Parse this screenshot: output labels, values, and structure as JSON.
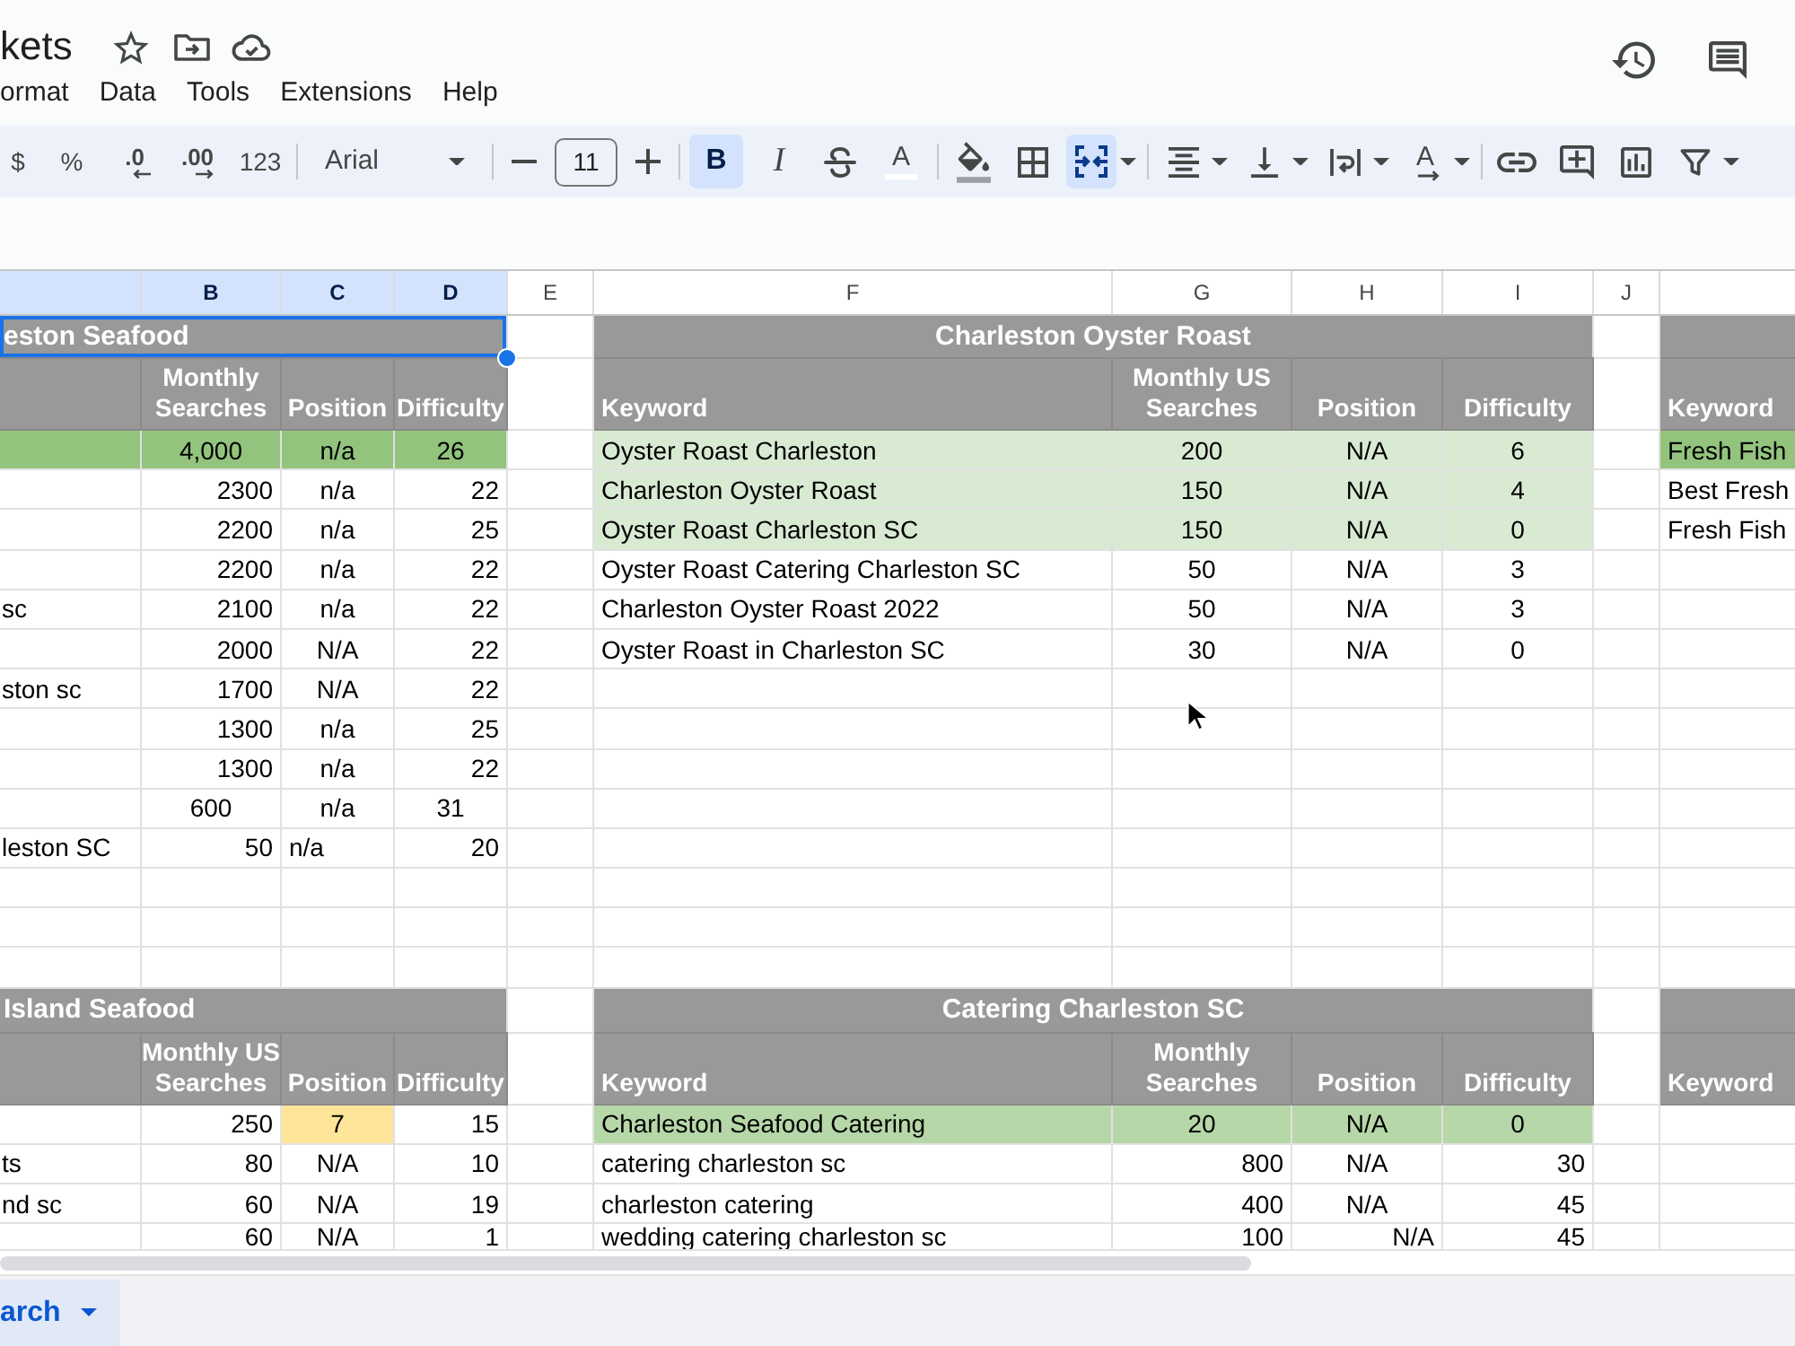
{
  "document": {
    "title": "kets"
  },
  "menu": [
    "ormat",
    "Data",
    "Tools",
    "Extensions",
    "Help"
  ],
  "toolbar": [
    {
      "kind": "text",
      "label": "$",
      "selected": false
    },
    {
      "kind": "text",
      "label": "%",
      "selected": false
    },
    {
      "kind": "decrease",
      "label": ".0",
      "selected": false
    },
    {
      "kind": "increase",
      "label": ".00",
      "selected": false
    },
    {
      "kind": "text",
      "label": "123",
      "selected": false
    },
    {
      "kind": "divider"
    },
    {
      "kind": "font",
      "label": "Arial"
    },
    {
      "kind": "divider"
    },
    {
      "kind": "size",
      "value": "11"
    },
    {
      "kind": "divider"
    },
    {
      "kind": "bold",
      "label": "B",
      "selected": true
    },
    {
      "kind": "italic",
      "label": "I",
      "selected": false
    },
    {
      "kind": "tool",
      "selected": false,
      "dropdown": false
    },
    {
      "kind": "text_color",
      "label": "A",
      "selected": false
    },
    {
      "kind": "divider"
    },
    {
      "kind": "tool",
      "selected": false,
      "dropdown": false
    },
    {
      "kind": "tool",
      "selected": false,
      "dropdown": false
    },
    {
      "kind": "tool",
      "selected": true,
      "dropdown": true
    },
    {
      "kind": "divider"
    },
    {
      "kind": "tool",
      "selected": false,
      "dropdown": true
    },
    {
      "kind": "tool",
      "selected": false,
      "dropdown": true
    },
    {
      "kind": "tool",
      "selected": false,
      "dropdown": true
    },
    {
      "kind": "rotation",
      "label": "A",
      "selected": false,
      "dropdown": true
    },
    {
      "kind": "divider"
    },
    {
      "kind": "tool",
      "selected": false,
      "dropdown": false
    },
    {
      "kind": "tool",
      "selected": false,
      "dropdown": false
    },
    {
      "kind": "tool",
      "selected": false,
      "dropdown": false
    },
    {
      "kind": "tool",
      "selected": false,
      "dropdown": true
    }
  ],
  "grid": {
    "columns": [
      {
        "selected": true
      },
      {
        "label": "B",
        "selected": true
      },
      {
        "label": "C",
        "selected": true
      },
      {
        "label": "D",
        "selected": true
      },
      {
        "label": "E",
        "selected": false
      },
      {
        "label": "F",
        "selected": false
      },
      {
        "label": "G",
        "selected": false
      },
      {
        "label": "H",
        "selected": false
      },
      {
        "label": "I",
        "selected": false
      },
      {
        "label": "J",
        "selected": false
      }
    ],
    "bands": [
      {
        "tables": [
          {
            "title": "eston Seafood",
            "selected": true,
            "headers": {
              "searches": "Monthly Searches",
              "position": "Position",
              "difficulty": "Difficulty"
            },
            "rows": [
              {
                "searches": "4,000",
                "position": "n/a",
                "difficulty": "26",
                "color": "#93c47d"
              },
              {
                "searches": "2300",
                "position": "n/a",
                "difficulty": "22"
              },
              {
                "searches": "2200",
                "position": "n/a",
                "difficulty": "25"
              },
              {
                "searches": "2200",
                "position": "n/a",
                "difficulty": "22"
              },
              {
                "column_1": "sc",
                "searches": "2100",
                "position": "n/a",
                "difficulty": "22"
              },
              {
                "searches": "2000",
                "position": "N/A",
                "difficulty": "22"
              },
              {
                "column_1": "ston sc",
                "searches": "1700",
                "position": "N/A",
                "difficulty": "22"
              },
              {
                "searches": "1300",
                "position": "n/a",
                "difficulty": "25"
              },
              {
                "searches": "1300",
                "position": "n/a",
                "difficulty": "22"
              },
              {
                "searches": "600",
                "position": "n/a",
                "difficulty": "31"
              },
              {
                "column_1": "leston SC",
                "searches": "50",
                "position": "n/a",
                "difficulty": "20"
              }
            ]
          },
          {
            "title": "Charleston Oyster Roast",
            "selected": false,
            "headers": {
              "keyword": "Keyword",
              "searches": "Monthly US Searches",
              "position": "Position",
              "difficulty": "Difficulty"
            },
            "rows": [
              {
                "keyword": "Oyster Roast Charleston",
                "searches": "200",
                "position": "N/A",
                "difficulty": "6",
                "color": "#d9ead3"
              },
              {
                "keyword": "Charleston Oyster Roast",
                "searches": "150",
                "position": "N/A",
                "difficulty": "4",
                "color": "#d9ead3"
              },
              {
                "keyword": "Oyster Roast Charleston SC",
                "searches": "150",
                "position": "N/A",
                "difficulty": "0",
                "color": "#d9ead3"
              },
              {
                "keyword": "Oyster Roast Catering Charleston SC",
                "searches": "50",
                "position": "N/A",
                "difficulty": "3"
              },
              {
                "keyword": "Charleston Oyster Roast 2022",
                "searches": "50",
                "position": "N/A",
                "difficulty": "3"
              },
              {
                "keyword": "Oyster Roast in Charleston SC",
                "searches": "30",
                "position": "N/A",
                "difficulty": "0"
              }
            ]
          },
          {
            "selected": false,
            "headers": {
              "keyword": "Keyword"
            },
            "rows": [
              {
                "keyword": "Fresh Fish",
                "color": "#93c47d"
              },
              {
                "keyword": "Best Fresh"
              },
              {
                "keyword": "Fresh Fish"
              }
            ]
          }
        ]
      },
      {
        "tables": [
          {
            "title": "Island Seafood",
            "selected": false,
            "headers": {
              "searches": "Monthly US Searches",
              "position": "Position",
              "difficulty": "Difficulty"
            },
            "rows": [
              {
                "searches": "250",
                "position": {
                  "text": "7",
                  "color": "#ffe599"
                },
                "difficulty": "15"
              },
              {
                "column_1": "ts",
                "searches": "80",
                "position": "N/A",
                "difficulty": "10"
              },
              {
                "column_1": "nd sc",
                "searches": "60",
                "position": "N/A",
                "difficulty": "19"
              },
              {
                "searches": "60",
                "position": "N/A",
                "difficulty": "1"
              }
            ]
          },
          {
            "title": "Catering Charleston SC",
            "selected": false,
            "headers": {
              "keyword": "Keyword",
              "searches": "Monthly Searches",
              "position": "Position",
              "difficulty": "Difficulty"
            },
            "rows": [
              {
                "keyword": "Charleston Seafood Catering",
                "searches": "20",
                "position": "N/A",
                "difficulty": "0",
                "color": "#b6d7a8"
              },
              {
                "keyword": "catering charleston sc",
                "searches": "800",
                "position": "N/A",
                "difficulty": "30"
              },
              {
                "keyword": "charleston catering",
                "searches": "400",
                "position": "N/A",
                "difficulty": "45"
              },
              {
                "keyword": "wedding catering charleston sc",
                "searches": "100",
                "position": "N/A",
                "difficulty": "45"
              }
            ]
          },
          {
            "selected": false,
            "headers": {
              "keyword": "Keyword"
            }
          }
        ]
      }
    ]
  },
  "sheet_tabs": [
    {
      "label": "arch",
      "selected": true
    }
  ]
}
